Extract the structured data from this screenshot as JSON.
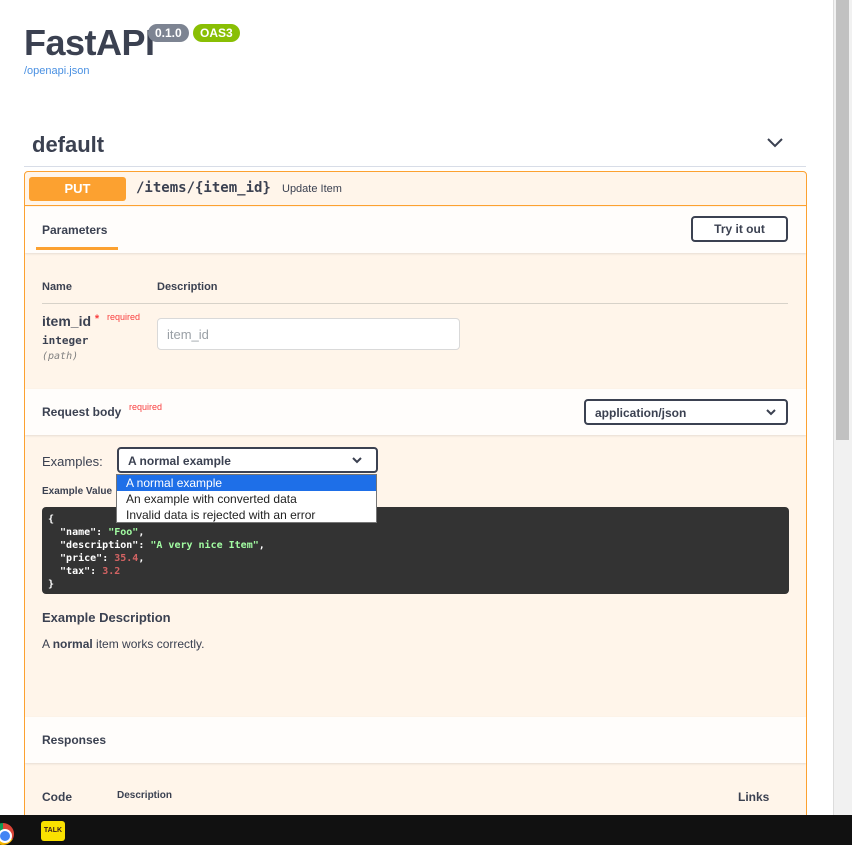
{
  "header": {
    "title": "FastAPI",
    "version": "0.1.0",
    "oas": "OAS3",
    "openapi_link": "/openapi.json"
  },
  "tag": {
    "name": "default",
    "icon": "chevron-down-icon"
  },
  "operation": {
    "method": "PUT",
    "path": "/items/{item_id}",
    "summary": "Update Item",
    "parameters_tab": "Parameters",
    "try_it_out": "Try it out",
    "columns": {
      "name": "Name",
      "description": "Description"
    },
    "param": {
      "name": "item_id",
      "star": "*",
      "required": "required",
      "type": "integer",
      "in": "(path)",
      "placeholder": "item_id"
    },
    "request_body": {
      "title": "Request body",
      "required": "required",
      "content_type": "application/json",
      "examples_label": "Examples:",
      "selected_example": "A normal example",
      "example_options": [
        "A normal example",
        "An example with converted data",
        "Invalid data is rejected with an error"
      ],
      "example_value_tab": "Example Value",
      "code_lines": {
        "open": "{",
        "name_key": "  \"name\"",
        "name_val": "\"Foo\"",
        "desc_key": "  \"description\"",
        "desc_val": "\"A very nice Item\"",
        "price_key": "  \"price\"",
        "price_val": "35.4",
        "tax_key": "  \"tax\"",
        "tax_val": "3.2",
        "close": "}"
      },
      "example_description_title": "Example Description",
      "example_description_prefix": "A ",
      "example_description_bold": "normal",
      "example_description_suffix": " item works correctly."
    },
    "responses": {
      "title": "Responses",
      "columns": {
        "code": "Code",
        "description": "Description",
        "links": "Links"
      }
    }
  },
  "taskbar": {
    "talk_label": "TALK"
  },
  "colors": {
    "put": "#fca130",
    "put_bg": "#fff5ea",
    "badge_version": "#7d8492",
    "badge_oas": "#89bf04",
    "link": "#4990e2",
    "required": "#f93e3e",
    "dropdown_selected": "#1e6fe8"
  }
}
